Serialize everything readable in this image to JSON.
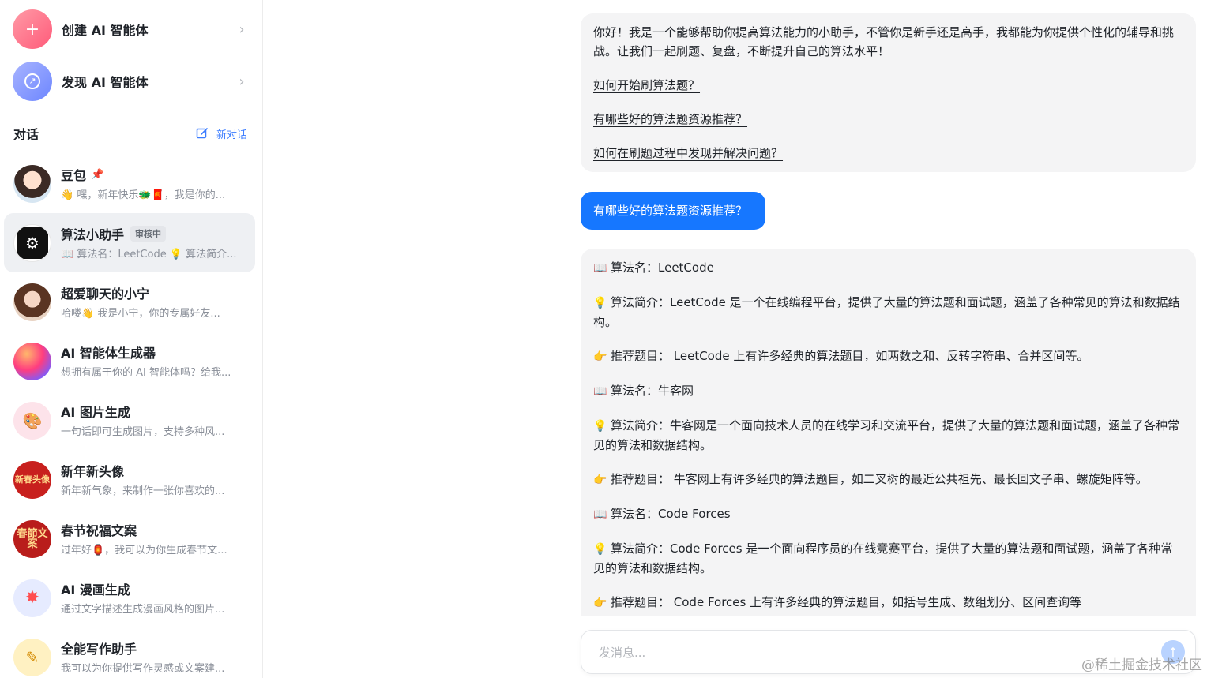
{
  "sidebar": {
    "create_label": "创建 AI 智能体",
    "discover_label": "发现 AI 智能体",
    "conversations_title": "对话",
    "new_chat_label": "新对话",
    "items": [
      {
        "name": "豆包",
        "preview": "👋 嘿，新年快乐🐲🧧，我是你的...",
        "pinned": true
      },
      {
        "name": "算法小助手",
        "badge": "审核中",
        "preview": "📖 算法名：LeetCode 💡 算法简介...",
        "active": true
      },
      {
        "name": "超爱聊天的小宁",
        "preview": "哈喽👋 我是小宁，你的专属好友..."
      },
      {
        "name": "AI 智能体生成器",
        "preview": "想拥有属于你的 AI 智能体吗？给我..."
      },
      {
        "name": "AI 图片生成",
        "preview": "一句话即可生成图片，支持多种风..."
      },
      {
        "name": "新年新头像",
        "preview": "新年新气象，来制作一张你喜欢的...",
        "avatar_text": "新春头像"
      },
      {
        "name": "春节祝福文案",
        "preview": "过年好🏮，我可以为你生成春节文...",
        "avatar_text": "春節文案"
      },
      {
        "name": "AI 漫画生成",
        "preview": "通过文字描述生成漫画风格的图片..."
      },
      {
        "name": "全能写作助手",
        "preview": "我可以为你提供写作灵感或文案建..."
      }
    ]
  },
  "chat": {
    "greeting": "你好！我是一个能够帮助你提高算法能力的小助手，不管你是新手还是高手，我都能为你提供个性化的辅导和挑战。让我们一起刷题、复盘，不断提升自己的算法水平！",
    "suggestions": [
      "如何开始刷算法题？",
      "有哪些好的算法题资源推荐？",
      "如何在刷题过程中发现并解决问题？"
    ],
    "user_message": "有哪些好的算法题资源推荐？",
    "answer": [
      {
        "icon": "📖",
        "text": "算法名：LeetCode"
      },
      {
        "icon": "💡",
        "text": "算法简介：LeetCode 是一个在线编程平台，提供了大量的算法题和面试题，涵盖了各种常见的算法和数据结构。"
      },
      {
        "icon": "👉",
        "text": "推荐题目： LeetCode 上有许多经典的算法题目，如两数之和、反转字符串、合并区间等。"
      },
      {
        "icon": "📖",
        "text": "算法名：牛客网"
      },
      {
        "icon": "💡",
        "text": "算法简介：牛客网是一个面向技术人员的在线学习和交流平台，提供了大量的算法题和面试题，涵盖了各种常见的算法和数据结构。"
      },
      {
        "icon": "👉",
        "text": "推荐题目： 牛客网上有许多经典的算法题目，如二叉树的最近公共祖先、最长回文子串、螺旋矩阵等。"
      },
      {
        "icon": "📖",
        "text": "算法名：Code Forces"
      },
      {
        "icon": "💡",
        "text": "算法简介：Code Forces 是一个面向程序员的在线竞赛平台，提供了大量的算法题和面试题，涵盖了各种常见的算法和数据结构。"
      },
      {
        "icon": "👉",
        "text": "推荐题目： Code Forces 上有许多经典的算法题目，如括号生成、数组划分、区间查询等"
      }
    ],
    "input_placeholder": "发消息..."
  },
  "watermark": "@稀土掘金技术社区",
  "colors": {
    "accent": "#1677ff",
    "bubble_bg": "#f4f4f5",
    "active_item_bg": "#eef0f3"
  }
}
